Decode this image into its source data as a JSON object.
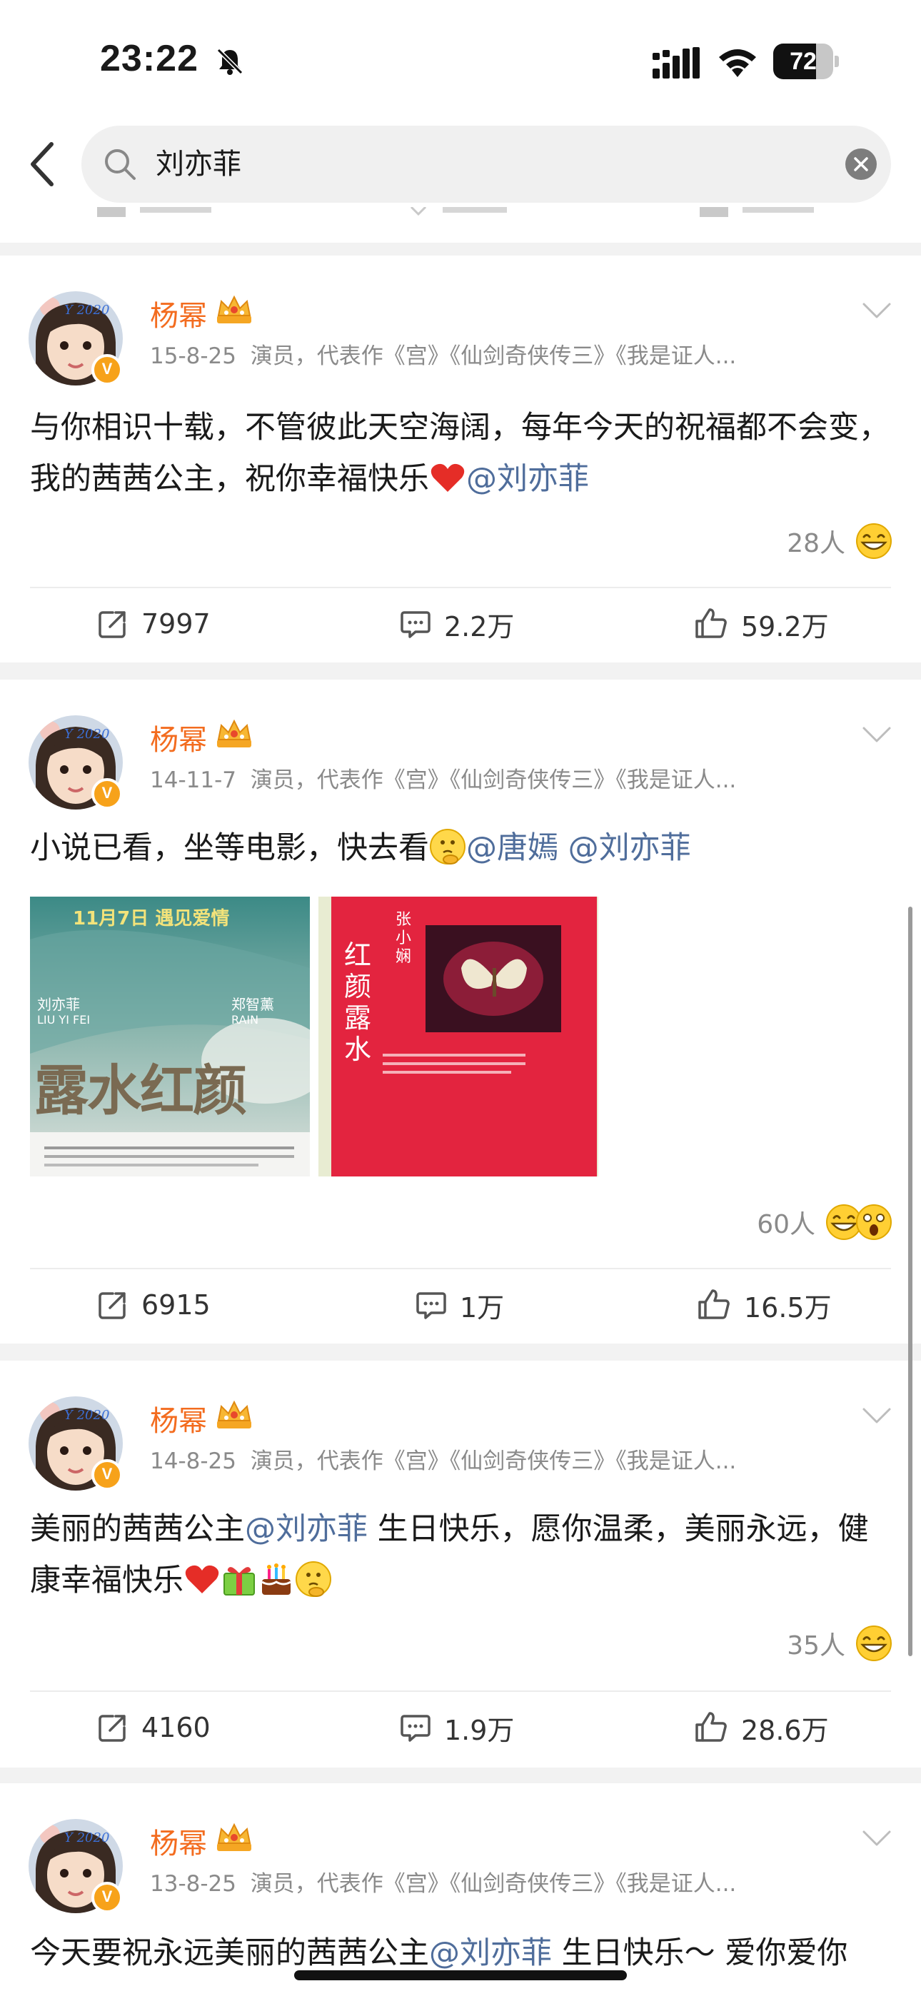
{
  "status_bar": {
    "time": "23:22",
    "battery": "72",
    "battery_level_percent": 72
  },
  "search": {
    "query": "刘亦菲"
  },
  "colors": {
    "accent_name": "#f36c1f",
    "mention": "#4f6d9b",
    "meta": "#8a8a8a"
  },
  "icons": [
    "chevron-left-icon",
    "search-icon",
    "clear-icon",
    "crown-icon",
    "verified-badge-icon",
    "chevron-down-icon",
    "repost-icon",
    "comment-icon",
    "like-icon"
  ],
  "posts": [
    {
      "username": "杨幂",
      "verified_badge": "V",
      "date": "15-8-25",
      "description": "演员，代表作《宫》《仙剑奇侠传三》《我是证人...",
      "text_1": "与你相识十载，不管彼此天空海阔，每年今天的祝福都不会变，我的茜茜公主，祝你幸福快乐",
      "mention_1": "@刘亦菲",
      "reaction_count": "28人",
      "reposts": "7997",
      "comments": "2.2万",
      "likes": "59.2万"
    },
    {
      "username": "杨幂",
      "verified_badge": "V",
      "date": "14-11-7",
      "description": "演员，代表作《宫》《仙剑奇侠传三》《我是证人...",
      "text_1": "小说已看，坐等电影，快去看",
      "mention_1": "@唐嫣",
      "mention_2": "@刘亦菲",
      "image_1": {
        "date_line": "11月7日  遇见爱情",
        "title": "露水红颜",
        "actor_1_cn": "刘亦菲",
        "actor_1_en": "LIU YI FEI",
        "actor_2_cn": "郑智薰",
        "actor_2_en": "RAIN"
      },
      "image_2": {
        "title": "红颜露水",
        "author": "张小娴"
      },
      "reaction_count": "60人",
      "reposts": "6915",
      "comments": "1万",
      "likes": "16.5万"
    },
    {
      "username": "杨幂",
      "verified_badge": "V",
      "date": "14-8-25",
      "description": "演员，代表作《宫》《仙剑奇侠传三》《我是证人...",
      "text_1": "美丽的茜茜公主",
      "mention_1": "@刘亦菲",
      "text_2": "生日快乐，愿你温柔，美丽永远，健康幸福快乐",
      "reaction_count": "35人",
      "reposts": "4160",
      "comments": "1.9万",
      "likes": "28.6万"
    },
    {
      "username": "杨幂",
      "verified_badge": "V",
      "date": "13-8-25",
      "description": "演员，代表作《宫》《仙剑奇侠传三》《我是证人...",
      "text_1": "今天要祝永远美丽的茜茜公主",
      "mention_1": "@刘亦菲",
      "text_2": "生日快乐～ 爱你爱你"
    }
  ]
}
